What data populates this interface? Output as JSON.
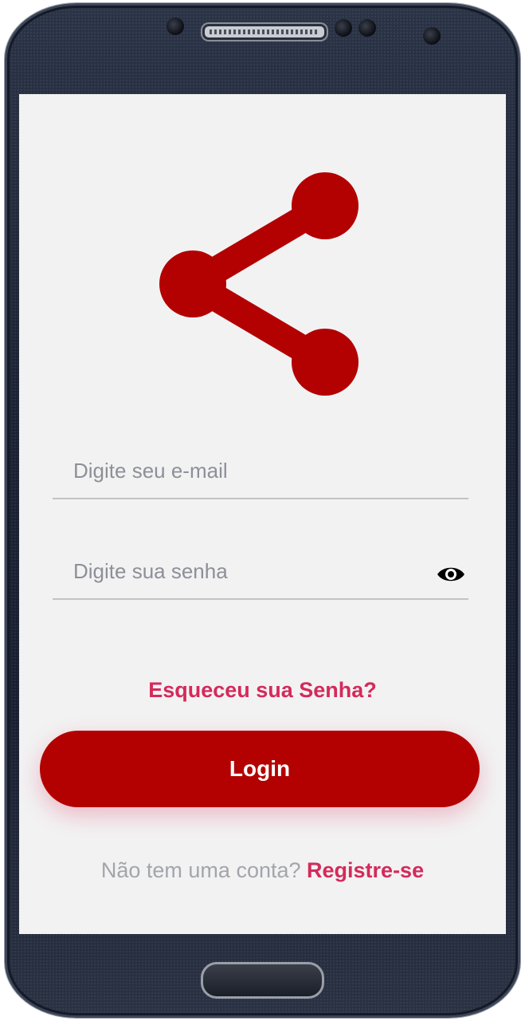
{
  "login": {
    "email_placeholder": "Digite seu e-mail",
    "password_placeholder": "Digite sua senha",
    "forgot_password": "Esqueceu sua Senha?",
    "login_button": "Login",
    "register_prompt": "Não tem uma conta?",
    "register_link": "Registre-se"
  },
  "icons": {
    "logo": "share-icon",
    "password_toggle": "eye-icon"
  },
  "colors": {
    "brand": "#b30000",
    "link": "#d42a5a",
    "background": "#f2f2f3"
  }
}
